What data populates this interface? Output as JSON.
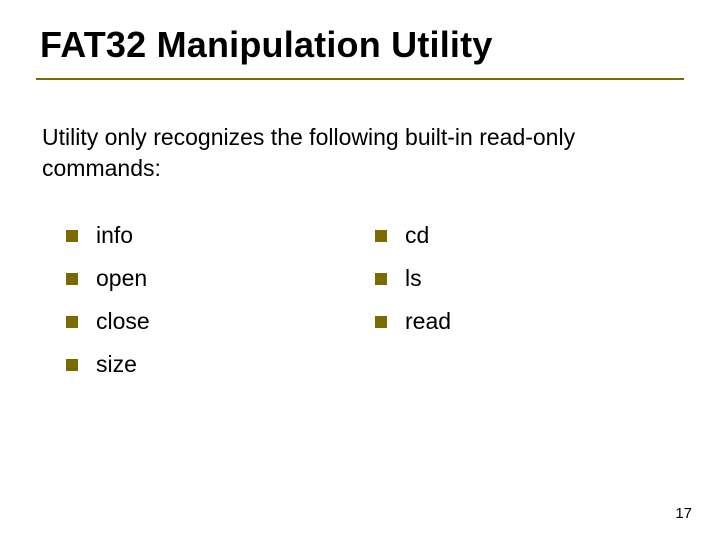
{
  "title": "FAT32 Manipulation Utility",
  "intro": "Utility only recognizes the following built-in read-only commands:",
  "left_items": [
    "info",
    "open",
    "close",
    "size"
  ],
  "right_items": [
    "cd",
    "ls",
    "read"
  ],
  "page_number": "17"
}
